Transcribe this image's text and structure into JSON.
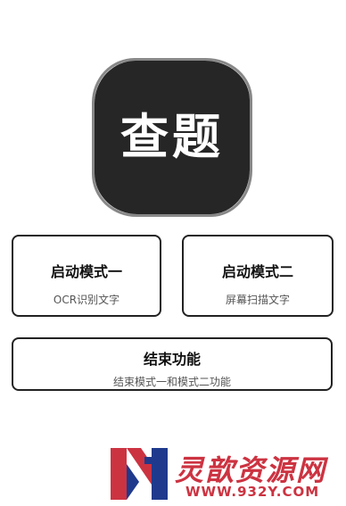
{
  "app": {
    "logo_text": "查题"
  },
  "modes": {
    "mode1": {
      "title": "启动模式一",
      "subtitle": "OCR识别文字"
    },
    "mode2": {
      "title": "启动模式二",
      "subtitle": "屏幕扫描文字"
    },
    "end": {
      "title": "结束功能",
      "subtitle": "结束模式一和模式二功能"
    }
  },
  "watermark": {
    "text": "灵歆资源网",
    "url": "WWW.932Y.COM",
    "colors": {
      "red": "#cc3341",
      "navy": "#1f3a8c"
    }
  },
  "colors": {
    "logo_bg": "#262626",
    "card_border": "#222222",
    "background": "#ffffff"
  }
}
